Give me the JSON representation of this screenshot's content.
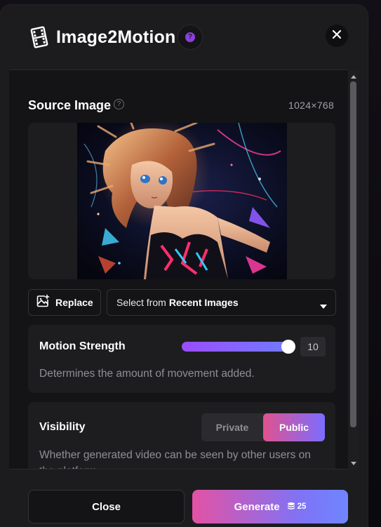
{
  "header": {
    "title": "Image2Motion",
    "title_icon": "film-strip-icon",
    "help_icon": "help-icon",
    "close_icon": "close-icon"
  },
  "source_image": {
    "label": "Source Image",
    "dimensions": "1024×768",
    "info_icon": "info-icon"
  },
  "image_actions": {
    "replace_label": "Replace",
    "select_prefix": "Select from",
    "select_bold": "Recent Images"
  },
  "motion_strength": {
    "label": "Motion Strength",
    "value": "10",
    "slider_fraction": 1.0,
    "description": "Determines the amount of movement added."
  },
  "visibility": {
    "label": "Visibility",
    "options": [
      "Private",
      "Public"
    ],
    "selected": "Public",
    "description": "Whether generated video can be seen by other users on the platform"
  },
  "footer": {
    "close_label": "Close",
    "generate_label": "Generate",
    "cost": "25",
    "cost_icon": "coin-stack-icon"
  },
  "colors": {
    "accent_purple": "#9a4dff",
    "accent_pink": "#e0528f",
    "accent_blue": "#6f86ff",
    "panel_bg": "#1c1c1f"
  }
}
